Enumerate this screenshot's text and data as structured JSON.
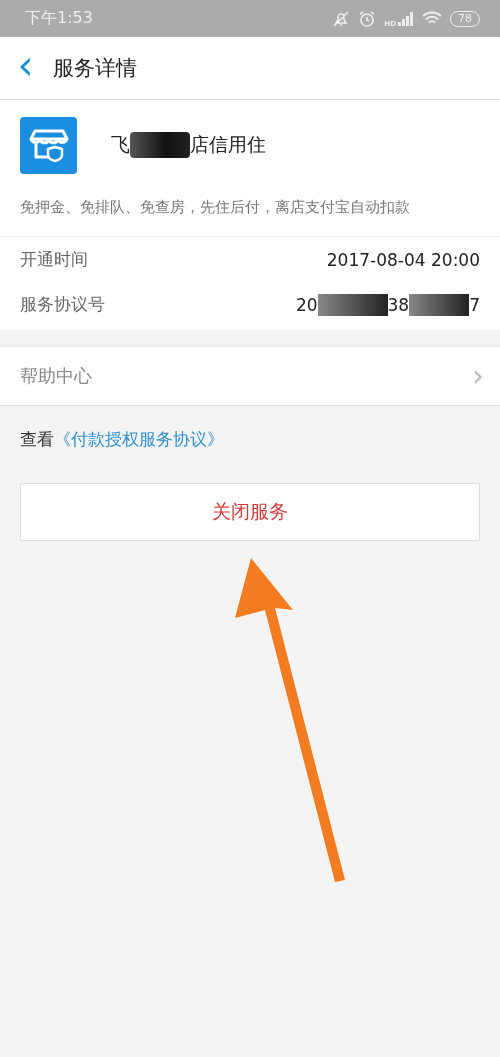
{
  "status_bar": {
    "time": "下午1:53",
    "network_label": "HD",
    "battery": "78"
  },
  "header": {
    "back": "‹",
    "title": "服务详情"
  },
  "service": {
    "name_parts": [
      "飞",
      "店信用住"
    ],
    "description": "免押金、免排队、免查房，先住后付，离店支付宝自动扣款"
  },
  "details": [
    {
      "label": "开通时间",
      "value_parts": [
        "2017-08-04 20:00"
      ]
    },
    {
      "label": "服务协议号",
      "value_parts": [
        "20",
        "38",
        "7"
      ]
    }
  ],
  "help": {
    "label": "帮助中心",
    "chevron": "›"
  },
  "agreement": {
    "prefix": "查看",
    "link": "《付款授权服务协议》"
  },
  "close_button": "关闭服务",
  "annotation": {
    "kind": "arrow"
  }
}
